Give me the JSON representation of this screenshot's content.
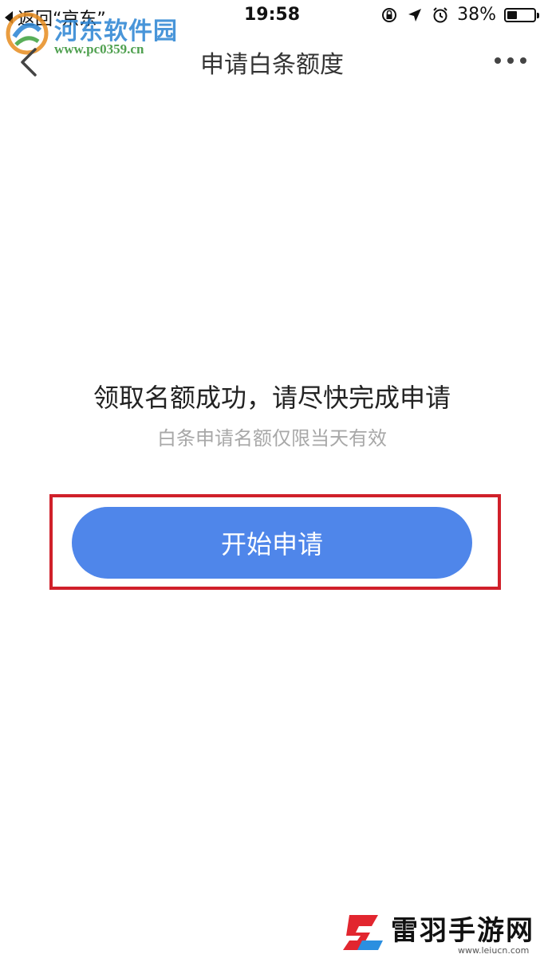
{
  "status_bar": {
    "back_label": "返回“京东”",
    "time": "19:58",
    "battery_percent_label": "38%",
    "battery_level": 0.38
  },
  "watermark_top": {
    "title": "河东软件园",
    "url": "www.pc0359.cn"
  },
  "nav": {
    "title": "申请白条额度"
  },
  "main": {
    "heading": "领取名额成功，请尽快完成申请",
    "subtext": "白条申请名额仅限当天有效",
    "apply_button_label": "开始申请"
  },
  "watermark_bottom": {
    "brand": "雷羽手游网",
    "url": "www.leiucn.com"
  },
  "colors": {
    "button": "#4f86ea",
    "highlight_border": "#d0202a",
    "subtext": "#a8a8a8"
  }
}
